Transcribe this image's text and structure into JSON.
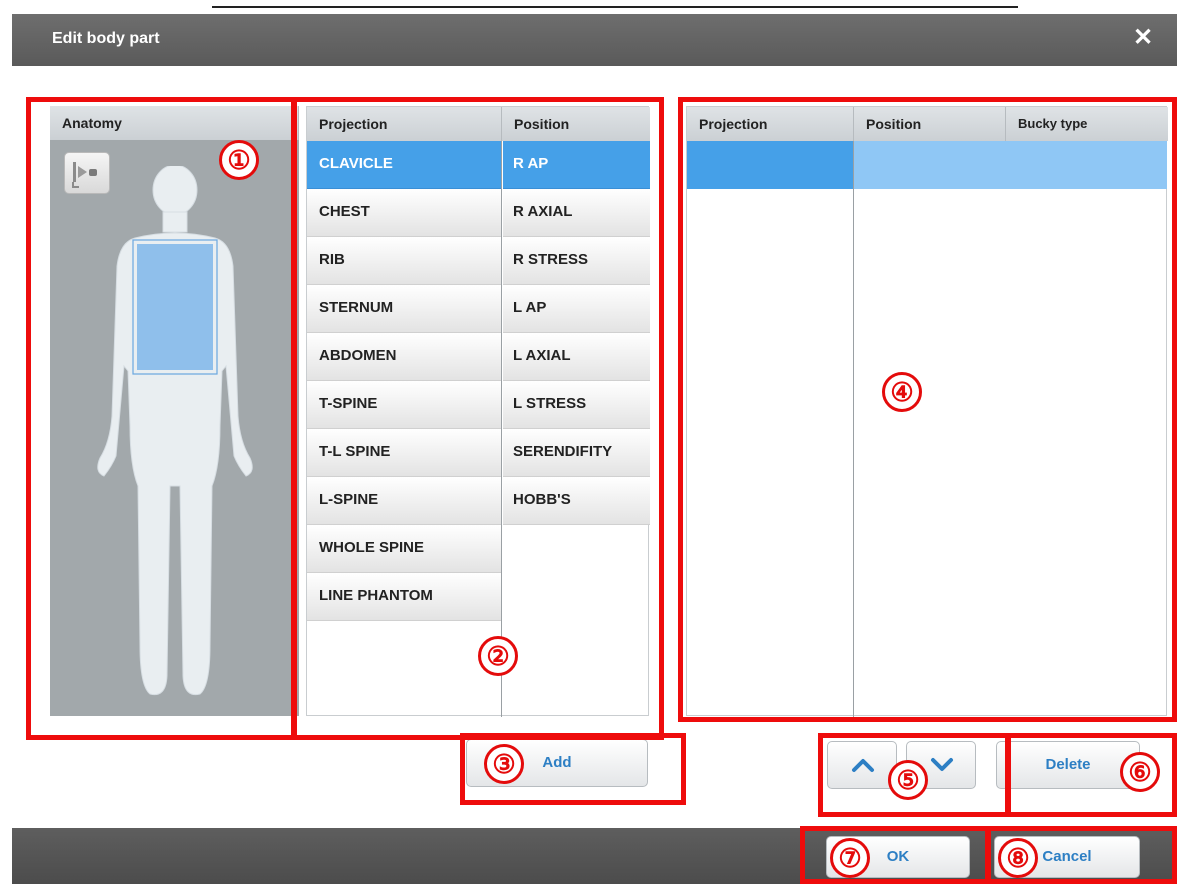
{
  "dialog": {
    "title": "Edit body part",
    "close_glyph": "✕"
  },
  "anatomy": {
    "header": "Anatomy",
    "view_icon": "xray-tube-icon"
  },
  "list": {
    "projection_header": "Projection",
    "position_header": "Position",
    "projections": [
      "CLAVICLE",
      "CHEST",
      "RIB",
      "STERNUM",
      "ABDOMEN",
      "T-SPINE",
      "T-L SPINE",
      "L-SPINE",
      "WHOLE SPINE",
      "LINE PHANTOM"
    ],
    "positions": [
      "R AP",
      "R AXIAL",
      "R STRESS",
      "L AP",
      "L AXIAL",
      "L STRESS",
      "SERENDIFITY",
      "HOBB'S"
    ],
    "selected_projection": "CLAVICLE",
    "selected_position": "R AP"
  },
  "table": {
    "headers": [
      "Projection",
      "Position",
      "Bucky type"
    ]
  },
  "buttons": {
    "add": "Add",
    "up_icon": "chevron-up-icon",
    "down_icon": "chevron-down-icon",
    "delete": "Delete",
    "ok": "OK",
    "cancel": "Cancel"
  },
  "callouts": [
    "①",
    "②",
    "③",
    "④",
    "⑤",
    "⑥",
    "⑦",
    "⑧"
  ],
  "colors": {
    "selection": "#45a0e8",
    "selection_light": "#8fc7f5",
    "callout_red": "#ee0c0c",
    "button_text": "#2d7fc4",
    "titlebar": "#636363"
  }
}
